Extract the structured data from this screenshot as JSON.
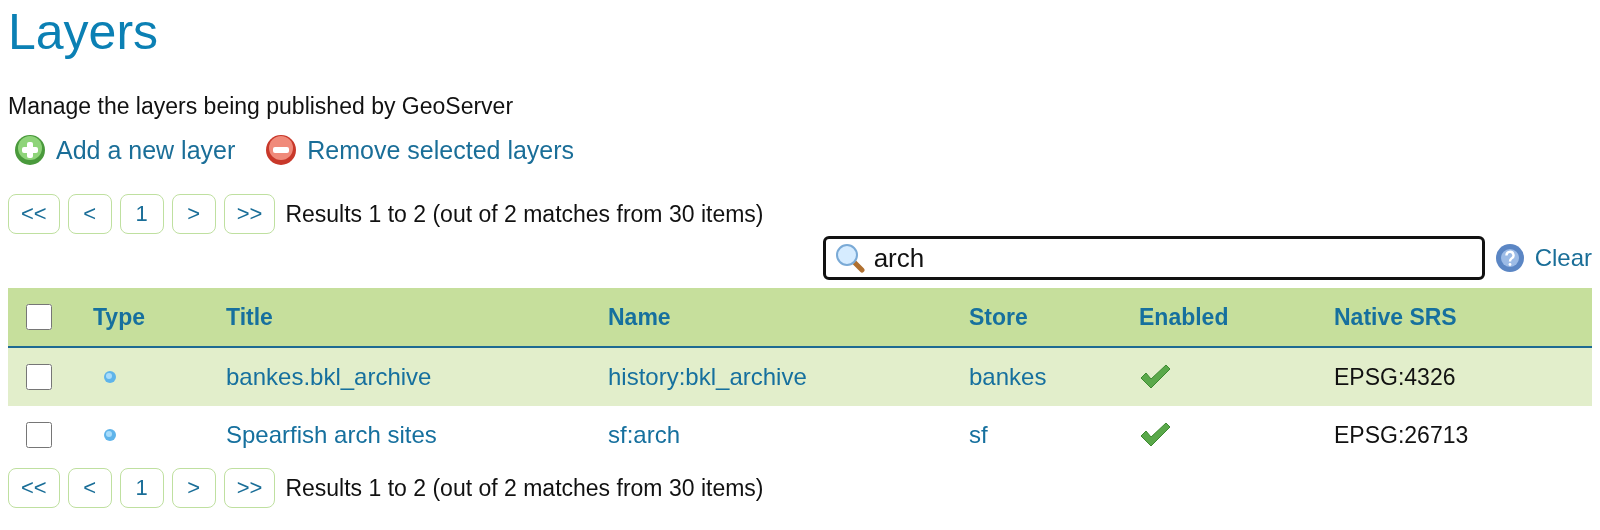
{
  "title": "Layers",
  "description": "Manage the layers being published by GeoServer",
  "actions": [
    {
      "kind": "add",
      "label": "Add a new layer"
    },
    {
      "kind": "remove",
      "label": "Remove selected layers"
    }
  ],
  "pager_top": {
    "buttons": [
      "<<",
      "<",
      "1",
      ">",
      ">>"
    ],
    "summary": "Results 1 to 2 (out of 2 matches from 30 items)"
  },
  "search": {
    "value": "arch",
    "clear": "Clear"
  },
  "table": {
    "columns": [
      "Type",
      "Title",
      "Name",
      "Store",
      "Enabled",
      "Native SRS"
    ],
    "header_checked": false,
    "rows": [
      {
        "checked": false,
        "title": "bankes.bkl_archive",
        "name": "history:bkl_archive",
        "store": "bankes",
        "enabled": true,
        "srs": "EPSG:4326"
      },
      {
        "checked": false,
        "title": "Spearfish arch sites",
        "name": "sf:arch",
        "store": "sf",
        "enabled": true,
        "srs": "EPSG:26713"
      }
    ]
  },
  "pager_bottom": {
    "buttons": [
      "<<",
      "<",
      "1",
      ">",
      ">>"
    ],
    "summary": "Results 1 to 2 (out of 2 matches from 30 items)"
  }
}
